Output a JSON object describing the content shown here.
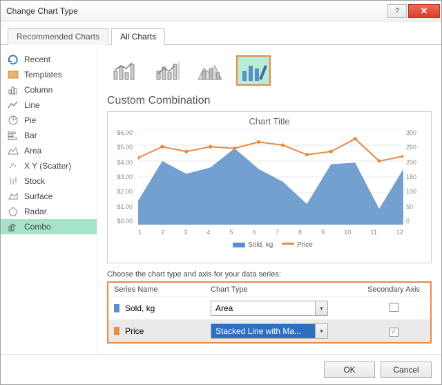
{
  "window": {
    "title": "Change Chart Type"
  },
  "tabs": {
    "recommended": "Recommended Charts",
    "all": "All Charts"
  },
  "sidebar": {
    "items": [
      {
        "label": "Recent"
      },
      {
        "label": "Templates"
      },
      {
        "label": "Column"
      },
      {
        "label": "Line"
      },
      {
        "label": "Pie"
      },
      {
        "label": "Bar"
      },
      {
        "label": "Area"
      },
      {
        "label": "X Y (Scatter)"
      },
      {
        "label": "Stock"
      },
      {
        "label": "Surface"
      },
      {
        "label": "Radar"
      },
      {
        "label": "Combo"
      }
    ]
  },
  "main": {
    "heading": "Custom Combination",
    "instruction": "Choose the chart type and axis for your data series:",
    "grid": {
      "headers": {
        "name": "Series Name",
        "type": "Chart Type",
        "axis": "Secondary Axis"
      },
      "rows": [
        {
          "name": "Sold, kg",
          "type": "Area",
          "secondary": false,
          "color": "#5a8fc7"
        },
        {
          "name": "Price",
          "type": "Stacked Line with Ma...",
          "secondary": true,
          "color": "#e98a45"
        }
      ]
    }
  },
  "buttons": {
    "ok": "OK",
    "cancel": "Cancel"
  },
  "chart_data": {
    "type": "combo",
    "title": "Chart Title",
    "x": [
      1,
      2,
      3,
      4,
      5,
      6,
      7,
      8,
      9,
      10,
      11,
      12
    ],
    "series": [
      {
        "name": "Sold, kg",
        "type": "area",
        "axis": "left",
        "color": "#5a8fc7",
        "values": [
          1.5,
          4.0,
          3.2,
          3.6,
          4.8,
          3.5,
          2.7,
          1.3,
          3.8,
          3.9,
          1.0,
          3.5
        ]
      },
      {
        "name": "Price",
        "type": "line-markers",
        "axis": "right",
        "color": "#e98a45",
        "values": [
          210,
          245,
          230,
          245,
          240,
          260,
          250,
          220,
          230,
          270,
          200,
          215
        ]
      }
    ],
    "left_axis": {
      "min": 0.0,
      "max": 6.0,
      "step": 1.0,
      "ticks": [
        "$6.00",
        "$5.00",
        "$4.00",
        "$3.00",
        "$2.00",
        "$1.00",
        "$0.00"
      ],
      "ylabel": ""
    },
    "right_axis": {
      "min": 0,
      "max": 300,
      "step": 50,
      "ticks": [
        "300",
        "250",
        "200",
        "150",
        "100",
        "50",
        "0"
      ],
      "ylabel": ""
    },
    "legend": {
      "items": [
        "Sold, kg",
        "Price"
      ]
    }
  }
}
